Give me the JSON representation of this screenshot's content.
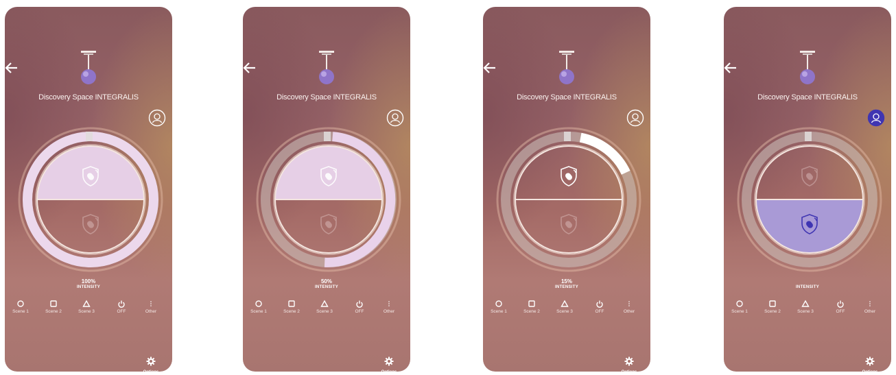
{
  "device_title": "Discovery Space INTEGRALIS",
  "intensity_label": "INTENSITY",
  "scenes": [
    {
      "label": "Scene 1",
      "icon": "circle-icon"
    },
    {
      "label": "Scene 2",
      "icon": "square-icon"
    },
    {
      "label": "Scene 3",
      "icon": "triangle-icon"
    },
    {
      "label": "OFF",
      "icon": "power-icon"
    },
    {
      "label": "Other",
      "icon": "more-icon"
    }
  ],
  "options_label": "Options",
  "colors": {
    "accent_lilac": "#e6cfe6",
    "active_purple": "#a99ad6",
    "icon_purple": "#3f35b2",
    "text_light": "#ffffff"
  },
  "screens": [
    {
      "intensity_percent": "100%",
      "intensity_level": 1.0,
      "active_segment": "top",
      "profile_active": false
    },
    {
      "intensity_percent": "50%",
      "intensity_level": 0.5,
      "active_segment": "top",
      "profile_active": false
    },
    {
      "intensity_percent": "15%",
      "intensity_level": 0.15,
      "active_segment": "none",
      "profile_active": false
    },
    {
      "intensity_percent": "",
      "intensity_level": 0.0,
      "active_segment": "bottom",
      "profile_active": true
    }
  ]
}
